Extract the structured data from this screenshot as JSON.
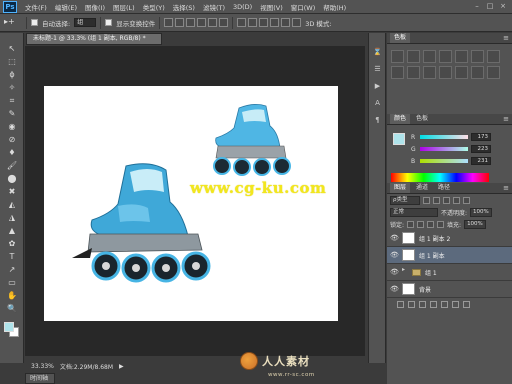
{
  "app": {
    "logo": "Ps",
    "menu": [
      "文件(F)",
      "编辑(E)",
      "图像(I)",
      "图层(L)",
      "类型(Y)",
      "选择(S)",
      "滤镜(T)",
      "3D(D)",
      "视图(V)",
      "窗口(W)",
      "帮助(H)"
    ],
    "window_controls": [
      "–",
      "□",
      "×"
    ]
  },
  "options": {
    "tool": "▸+",
    "auto_select_label": "自动选择:",
    "auto_select_value": "组",
    "transform_label": "显示变换控件",
    "mode_3d": "3D 模式:"
  },
  "tools": [
    "↖",
    "⬚",
    "ϕ",
    "✧",
    "⌗",
    "✎",
    "◉",
    "⊘",
    "♦",
    "🖌",
    "⬤",
    "✖",
    "◭",
    "◮",
    "▲",
    "✿",
    "T",
    "↗",
    "▭",
    "✋",
    "🔍"
  ],
  "document": {
    "tab_title": "未标题-1 @ 33.3% (组 1 副本, RGB/8) *",
    "zoom": "33.33%",
    "doc_info": "文档:2.29M/8.68M",
    "bottom_tab": "时间轴"
  },
  "watermark": {
    "url": "www.cg-ku.com",
    "logo_text": "人人素材",
    "logo_url": "www.rr-sc.com"
  },
  "panels": {
    "swatches_tab": "色板",
    "color_tabs": [
      "颜色",
      "色板"
    ],
    "color_rows": [
      {
        "letter": "R",
        "value": "173"
      },
      {
        "letter": "G",
        "value": "223"
      },
      {
        "letter": "B",
        "value": "231"
      }
    ],
    "layers_tabs": [
      "图层",
      "通道",
      "路径"
    ],
    "kind_label": "ρ类型",
    "blend_mode": "正常",
    "opacity_label": "不透明度:",
    "opacity_value": "100%",
    "lock_label": "锁定:",
    "fill_label": "填充:",
    "fill_value": "100%",
    "layers": [
      {
        "name": "组 1 副本 2",
        "type": "layer",
        "selected": false
      },
      {
        "name": "组 1 副本",
        "type": "layer",
        "selected": true
      },
      {
        "name": "组 1",
        "type": "group",
        "selected": false
      },
      {
        "name": "背景",
        "type": "background",
        "selected": false
      }
    ]
  },
  "colors": {
    "foreground": "#aee3ea",
    "background": "#ffffff",
    "skate_blue": "#3fa8d8",
    "selected_layer": "#5c6a7d"
  }
}
